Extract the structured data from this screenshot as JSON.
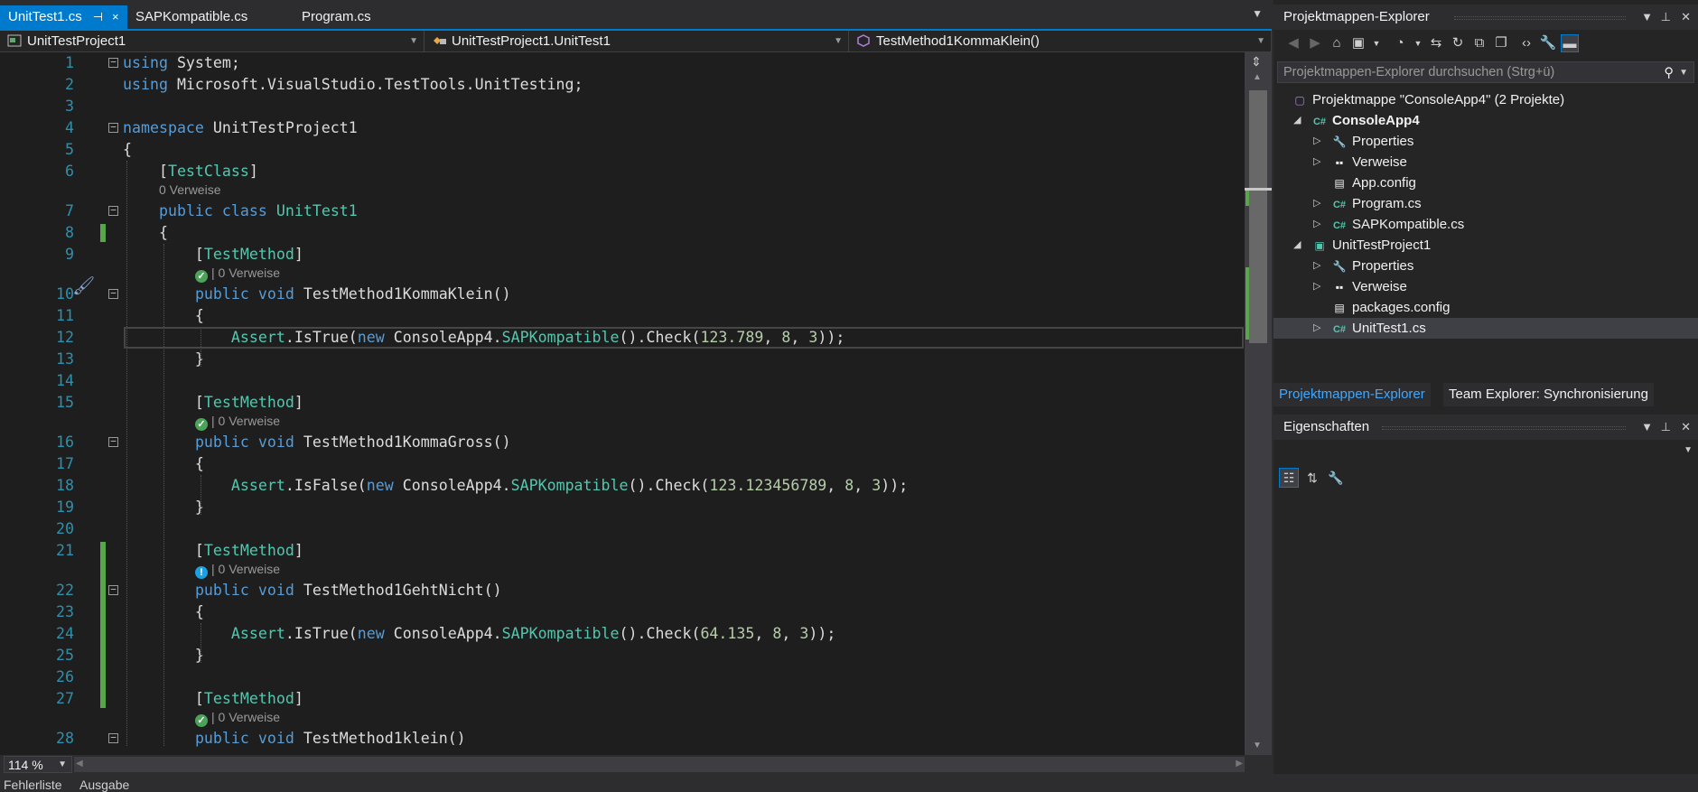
{
  "tabs": [
    {
      "label": "UnitTest1.cs",
      "active": true,
      "pin": "⊣",
      "close": "×"
    },
    {
      "label": "SAPKompatible.cs",
      "active": false
    },
    {
      "label": "Program.cs",
      "active": false
    }
  ],
  "nav": {
    "project": "UnitTestProject1",
    "class": "UnitTestProject1.UnitTest1",
    "member": "TestMethod1KommaKlein()"
  },
  "code_lines": [
    {
      "n": "1",
      "html": "<span class='kw'>using</span> System;"
    },
    {
      "n": "2",
      "html": "<span class='kw'>using</span> Microsoft.VisualStudio.TestTools.UnitTesting;"
    },
    {
      "n": "3",
      "html": ""
    },
    {
      "n": "4",
      "html": "<span class='kw'>namespace</span> UnitTestProject1"
    },
    {
      "n": "5",
      "html": "{"
    },
    {
      "n": "6",
      "html": "    [<span class='ty'>TestClass</span>]"
    },
    {
      "n": "7",
      "html": "    <span class='kw'>public</span> <span class='kw'>class</span> <span class='ty'>UnitTest1</span>"
    },
    {
      "n": "8",
      "html": "    {"
    },
    {
      "n": "9",
      "html": "        [<span class='ty'>TestMethod</span>]"
    },
    {
      "n": "10",
      "html": "        <span class='kw'>public</span> <span class='kw'>void</span> TestMethod1KommaKlein()"
    },
    {
      "n": "11",
      "html": "        {"
    },
    {
      "n": "12",
      "html": "            <span class='ty'>Assert</span>.IsTrue(<span class='kw'>new</span> ConsoleApp4.<span class='ty'>SAPKompatible</span>().Check(<span class='nm'>123.789</span>, <span class='nm'>8</span>, <span class='nm'>3</span>));"
    },
    {
      "n": "13",
      "html": "        }"
    },
    {
      "n": "14",
      "html": ""
    },
    {
      "n": "15",
      "html": "        [<span class='ty'>TestMethod</span>]"
    },
    {
      "n": "16",
      "html": "        <span class='kw'>public</span> <span class='kw'>void</span> TestMethod1KommaGross()"
    },
    {
      "n": "17",
      "html": "        {"
    },
    {
      "n": "18",
      "html": "            <span class='ty'>Assert</span>.IsFalse(<span class='kw'>new</span> ConsoleApp4.<span class='ty'>SAPKompatible</span>().Check(<span class='nm'>123.123456789</span>, <span class='nm'>8</span>, <span class='nm'>3</span>));"
    },
    {
      "n": "19",
      "html": "        }"
    },
    {
      "n": "20",
      "html": ""
    },
    {
      "n": "21",
      "html": "        [<span class='ty'>TestMethod</span>]"
    },
    {
      "n": "22",
      "html": "        <span class='kw'>public</span> <span class='kw'>void</span> TestMethod1GehtNicht()"
    },
    {
      "n": "23",
      "html": "        {"
    },
    {
      "n": "24",
      "html": "            <span class='ty'>Assert</span>.IsTrue(<span class='kw'>new</span> ConsoleApp4.<span class='ty'>SAPKompatible</span>().Check(<span class='nm'>64.135</span>, <span class='nm'>8</span>, <span class='nm'>3</span>));"
    },
    {
      "n": "25",
      "html": "        }"
    },
    {
      "n": "26",
      "html": ""
    },
    {
      "n": "27",
      "html": "        [<span class='ty'>TestMethod</span>]"
    },
    {
      "n": "28",
      "html": "        <span class='kw'>public</span> <span class='kw'>void</span> TestMethod1klein()"
    }
  ],
  "codelens": {
    "class_refs": "0 Verweise",
    "m1": {
      "status": "passed",
      "refs": "| 0 Verweise"
    },
    "m2": {
      "status": "passed",
      "refs": "| 0 Verweise"
    },
    "m3": {
      "status": "failed",
      "refs": "| 0 Verweise"
    },
    "m4": {
      "status": "passed",
      "refs": "| 0 Verweise"
    }
  },
  "zoom": "114 %",
  "bottom_tabs": [
    "Fehlerliste",
    "Ausgabe"
  ],
  "solution_explorer": {
    "title": "Projektmappen-Explorer",
    "search_placeholder": "Projektmappen-Explorer durchsuchen (Strg+ü)",
    "solution": "Projektmappe \"ConsoleApp4\" (2 Projekte)",
    "items": [
      {
        "label": "ConsoleApp4",
        "icon": "csharp-project-icon",
        "bold": true,
        "level": 1,
        "exp": "◢"
      },
      {
        "label": "Properties",
        "icon": "wrench-icon",
        "level": 2,
        "exp": "▷"
      },
      {
        "label": "Verweise",
        "icon": "references-icon",
        "level": 2,
        "exp": "▷"
      },
      {
        "label": "App.config",
        "icon": "config-file-icon",
        "level": 2,
        "exp": ""
      },
      {
        "label": "Program.cs",
        "icon": "csharp-file-icon",
        "level": 2,
        "exp": "▷"
      },
      {
        "label": "SAPKompatible.cs",
        "icon": "csharp-file-icon",
        "level": 2,
        "exp": "▷"
      },
      {
        "label": "UnitTestProject1",
        "icon": "test-project-icon",
        "level": 1,
        "exp": "◢"
      },
      {
        "label": "Properties",
        "icon": "wrench-icon",
        "level": 2,
        "exp": "▷"
      },
      {
        "label": "Verweise",
        "icon": "references-icon",
        "level": 2,
        "exp": "▷"
      },
      {
        "label": "packages.config",
        "icon": "config-file-icon",
        "level": 2,
        "exp": ""
      },
      {
        "label": "UnitTest1.cs",
        "icon": "csharp-file-icon",
        "level": 2,
        "exp": "▷",
        "selected": true
      }
    ],
    "bottom_tabs": [
      "Projektmappen-Explorer",
      "Team Explorer: Synchronisierung"
    ]
  },
  "properties": {
    "title": "Eigenschaften"
  },
  "colors": {
    "accent": "#007acc",
    "keyword": "#569cd6",
    "type": "#4ec9b0",
    "number": "#b5cea8",
    "linenum": "#2b91af",
    "change": "#57a64a"
  }
}
